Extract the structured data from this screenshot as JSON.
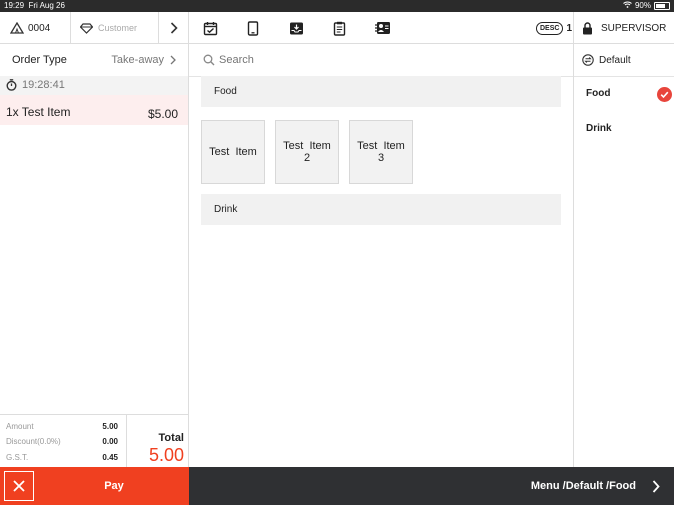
{
  "status_bar": {
    "time": "19:29",
    "date": "Fri Aug 26",
    "battery": "90%"
  },
  "top_bar": {
    "order_number": "0004",
    "customer_placeholder": "Customer",
    "desc_badge": "DESC",
    "desc_count": "1",
    "user_role": "SUPERVISOR",
    "tool_icons": [
      "calendar-check-icon",
      "tablet-icon",
      "inbox-download-icon",
      "clipboard-icon",
      "contact-card-icon"
    ]
  },
  "order": {
    "type_label": "Order Type",
    "type_value": "Take-away",
    "timestamp": "19:28:41",
    "items": [
      {
        "name": "1x Test Item",
        "price": "$5.00"
      }
    ]
  },
  "totals": {
    "amount_label": "Amount",
    "amount_value": "5.00",
    "discount_label": "Discount(0.0%)",
    "discount_value": "0.00",
    "gst_label": "G.S.T.",
    "gst_value": "0.45",
    "total_label": "Total",
    "total_value": "5.00"
  },
  "search": {
    "placeholder": "Search"
  },
  "categories": [
    {
      "name": "Food",
      "items": [
        "Test  Item",
        "Test  Item\n2",
        "Test  Item\n3"
      ]
    },
    {
      "name": "Drink",
      "items": []
    }
  ],
  "menu": {
    "name": "Default",
    "items": [
      {
        "label": "Food",
        "selected": true
      },
      {
        "label": "Drink",
        "selected": false
      }
    ]
  },
  "bottom_bar": {
    "pay_label": "Pay",
    "breadcrumb": "Menu /Default /Food"
  },
  "colors": {
    "accent": "#f04020",
    "selected_check": "#e8453c",
    "dark_bar": "#2f3033"
  }
}
